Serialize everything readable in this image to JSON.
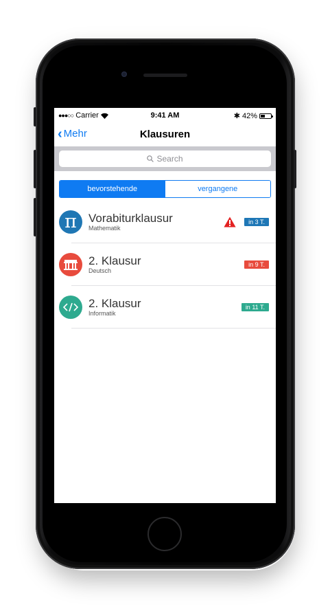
{
  "status_bar": {
    "carrier": "Carrier",
    "time": "9:41 AM",
    "battery": "42%",
    "battery_level": 0.42
  },
  "nav": {
    "back_label": "Mehr",
    "title": "Klausuren"
  },
  "search": {
    "placeholder": "Search"
  },
  "segments": {
    "upcoming": "bevorstehende",
    "past": "vergangene",
    "selected": "bevorstehende"
  },
  "exams": [
    {
      "title": "Vorabiturklausur",
      "subject": "Mathematik",
      "icon": "pi-icon",
      "icon_color": "#1f77b4",
      "badge": "in 3 T.",
      "badge_color": "#1e77b6",
      "warning": true,
      "warning_color": "#e32222"
    },
    {
      "title": "2. Klausur",
      "subject": "Deutsch",
      "icon": "brandenburg-gate-icon",
      "icon_color": "#e84b3d",
      "badge": "in 9 T.",
      "badge_color": "#e84b3d",
      "warning": false
    },
    {
      "title": "2. Klausur",
      "subject": "Informatik",
      "icon": "code-icon",
      "icon_color": "#2eaa8f",
      "badge": "in 11 T.",
      "badge_color": "#2eaa8f",
      "warning": false
    }
  ],
  "colors": {
    "accent": "#0f7bf2"
  }
}
